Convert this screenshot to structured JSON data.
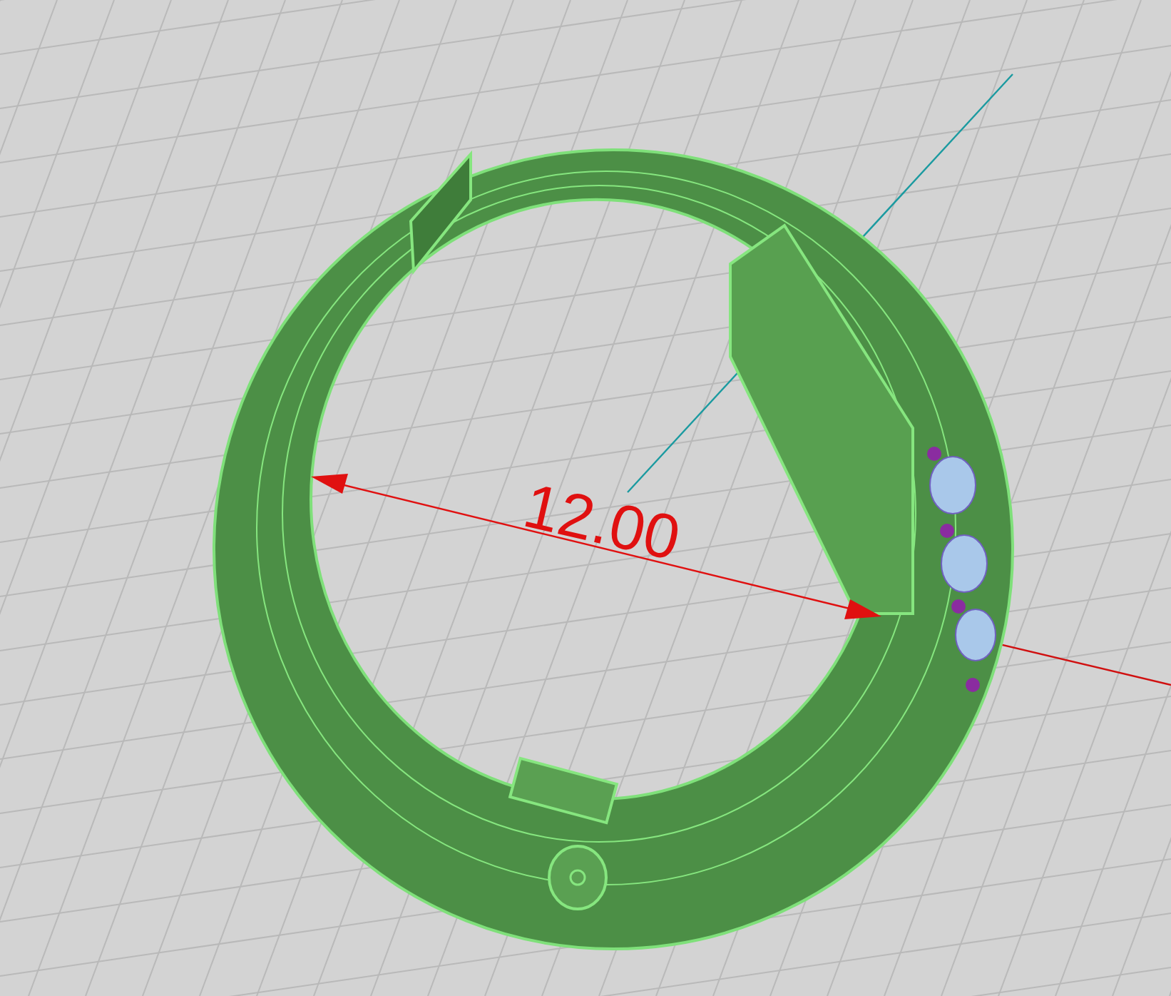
{
  "viewport": {
    "dimension": {
      "text": "12.00"
    }
  }
}
